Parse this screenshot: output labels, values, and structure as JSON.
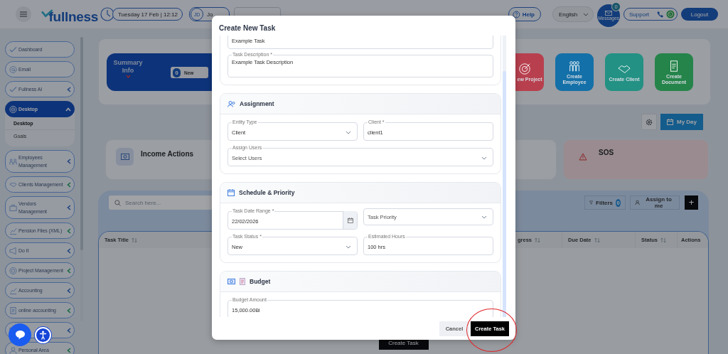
{
  "header": {
    "date_time": "Tuesday 17 Feb | 12:12",
    "user_initials": "JD",
    "user_name": "Jo",
    "help": "Help",
    "language": "English",
    "messages": {
      "label": "Messages",
      "badge": "0"
    },
    "support": "Support",
    "logout": "Logout"
  },
  "logo": {
    "name": "fullness"
  },
  "sidebar": {
    "items": [
      {
        "kind": "link",
        "label": "Dashboard",
        "selected": false
      },
      {
        "kind": "link",
        "label": "Email",
        "selected": false
      },
      {
        "kind": "menu",
        "label": "Fullness AI",
        "selected": false,
        "expanded": false
      },
      {
        "kind": "menu",
        "label": "Desktop",
        "selected": true,
        "expanded": true,
        "children": [
          {
            "label": "Desktop",
            "selected": true
          },
          {
            "label": "Goals",
            "selected": false
          }
        ]
      },
      {
        "kind": "menu",
        "label": "Employees Management",
        "selected": false,
        "expanded": false
      },
      {
        "kind": "menu",
        "label": "Clients Management",
        "selected": false,
        "expanded": false
      },
      {
        "kind": "menu",
        "label": "Vendors Management",
        "selected": false,
        "expanded": false
      },
      {
        "kind": "menu",
        "label": "Pension Files (XML)",
        "selected": false,
        "expanded": false
      },
      {
        "kind": "menu",
        "label": "Do It",
        "selected": false,
        "expanded": false
      },
      {
        "kind": "menu",
        "label": "Project Management",
        "selected": false,
        "expanded": false
      },
      {
        "kind": "menu",
        "label": "Accounting",
        "selected": false,
        "expanded": false
      },
      {
        "kind": "menu",
        "label": "online accounting",
        "selected": false,
        "expanded": false
      },
      {
        "kind": "menu",
        "selected": false,
        "expanded": false
      },
      {
        "kind": "menu",
        "label": "Personal Area",
        "selected": false,
        "expanded": false
      }
    ]
  },
  "summary": {
    "title": "Summary Info",
    "new_count": "0",
    "new_label": "New"
  },
  "quick_actions": [
    {
      "label": "ew Project",
      "color": "#b8404e"
    },
    {
      "label": "Create Employee",
      "color": "#1470a8"
    },
    {
      "label": "Create Client",
      "color": "#239184"
    },
    {
      "label": "Create Document",
      "color": "#25844a"
    }
  ],
  "my_day": "My Day",
  "info_cards": [
    {
      "kind": "income",
      "title": "Income Actions"
    },
    {
      "kind": "sos",
      "title": "SOS"
    }
  ],
  "tasks": {
    "search_placeholder": "Search here...",
    "filters": {
      "label": "Filters",
      "count": "0"
    },
    "assign_to_me": "Assign to me",
    "add": "+",
    "columns": [
      {
        "label": "Task Title",
        "sortable": true
      },
      {
        "label": "gress",
        "sortable": true
      },
      {
        "label": "Due Date",
        "sortable": true
      },
      {
        "label": "Status",
        "sortable": true
      },
      {
        "label": "Actions",
        "sortable": false
      }
    ],
    "create_button": "Create Task"
  },
  "modal": {
    "title": "Create New Task",
    "sections": [
      {
        "kind": "details",
        "rows": [
          [
            {
              "kind": "text",
              "value": "Example Task"
            }
          ],
          [
            {
              "kind": "textarea",
              "label": "Task Description *",
              "value": "Example Task Description"
            }
          ]
        ]
      },
      {
        "kind": "assignment",
        "title": "Assignment",
        "rows": [
          [
            {
              "kind": "select",
              "label": "Entity Type",
              "value": "Client"
            },
            {
              "kind": "text",
              "label": "Client *",
              "value": "client1"
            }
          ],
          [
            {
              "kind": "select",
              "label": "Assign Users",
              "placeholder": "Select Users"
            }
          ]
        ]
      },
      {
        "kind": "schedule",
        "title": "Schedule & Priority",
        "rows": [
          [
            {
              "kind": "date",
              "label": "Task Date Range *",
              "value": "22/02/2026"
            },
            {
              "kind": "select",
              "placeholder": "Task Priority"
            }
          ],
          [
            {
              "kind": "select",
              "label": "Task Status *",
              "value": "New"
            },
            {
              "kind": "text",
              "label": "Estimated Hours",
              "value": "100 hrs"
            }
          ]
        ]
      },
      {
        "kind": "budget",
        "title": "Budget",
        "rows": [
          [
            {
              "kind": "text",
              "label": "Budget Amount",
              "value": "15,000.00₪"
            }
          ]
        ]
      }
    ],
    "buttons": [
      {
        "kind": "secondary",
        "label": "Cancel",
        "circled": false
      },
      {
        "kind": "primary",
        "label": "Create Task",
        "circled": true
      }
    ]
  }
}
